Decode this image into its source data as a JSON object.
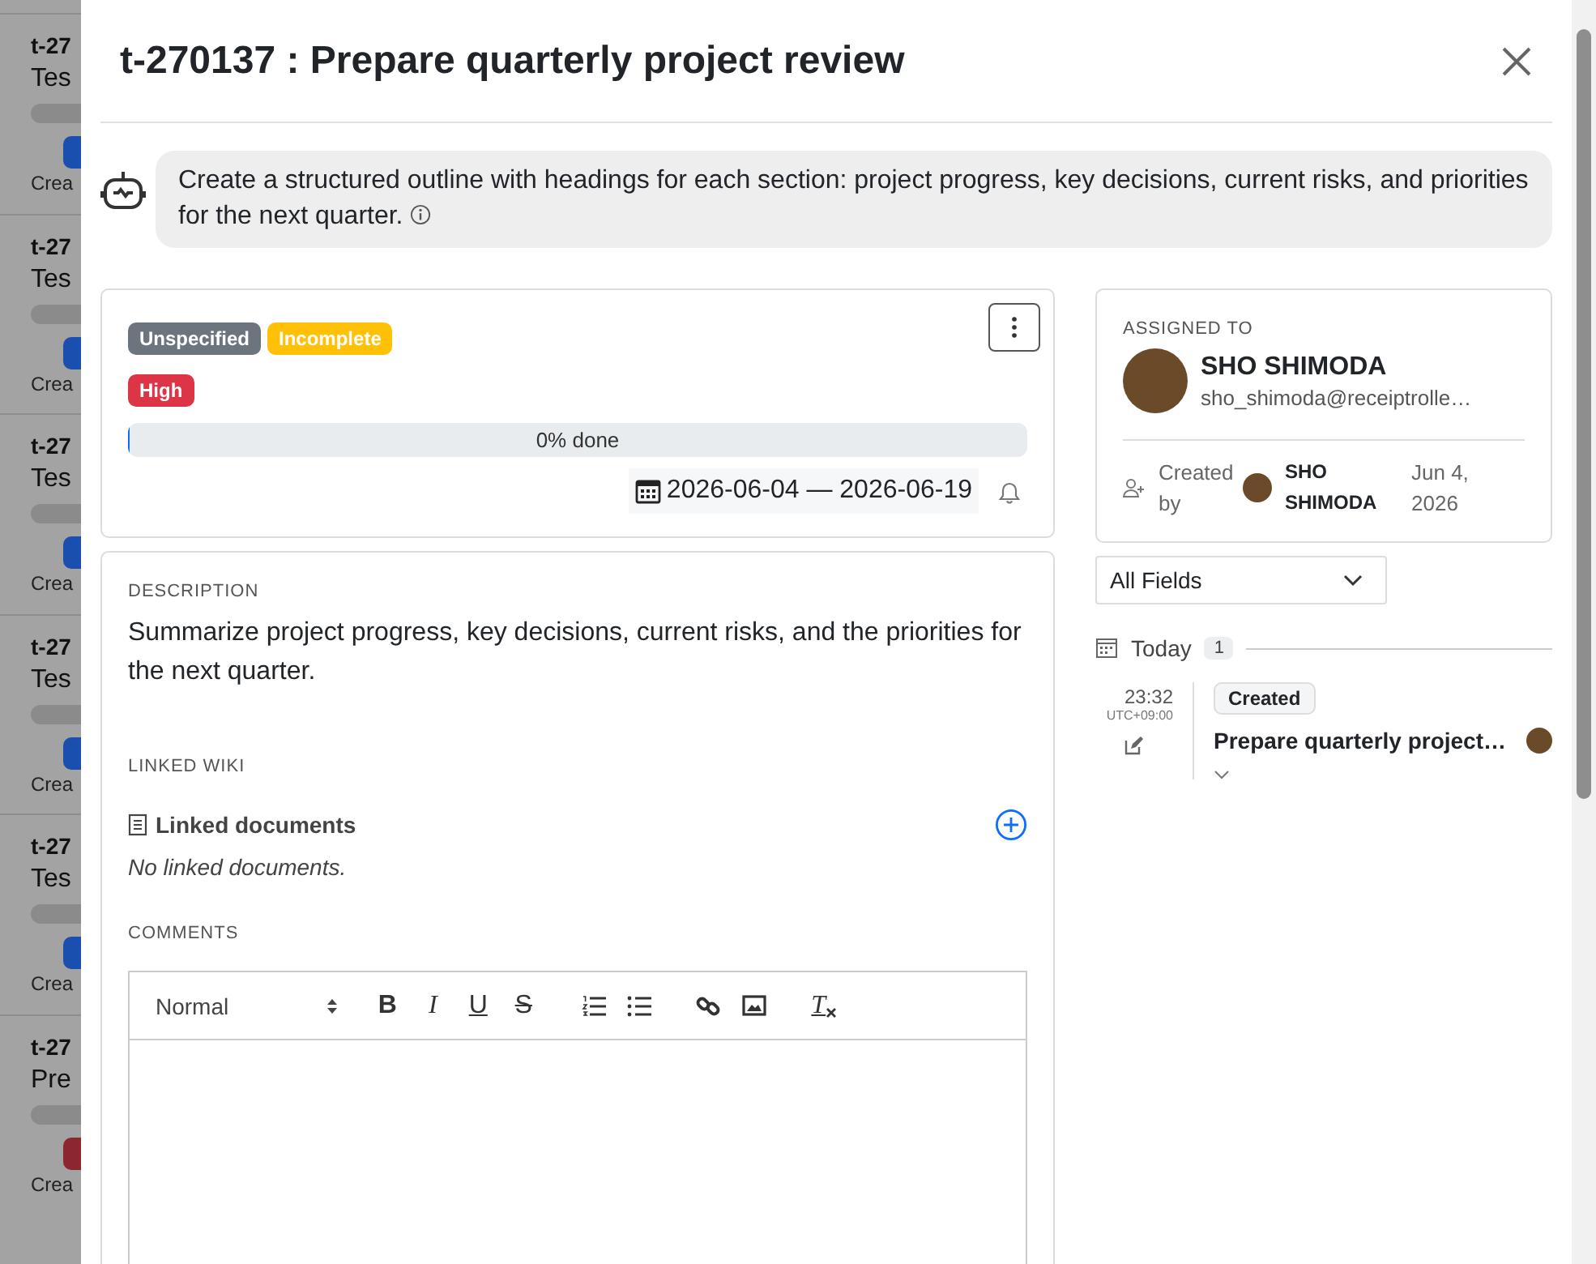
{
  "background_list": [
    {
      "id": "t-27",
      "title": "Tes",
      "color": "#1a4fb0",
      "meta": "Crea"
    },
    {
      "id": "t-27",
      "title": "Tes",
      "color": "#1a4fb0",
      "meta": "Crea"
    },
    {
      "id": "t-27",
      "title": "Tes",
      "color": "#1a4fb0",
      "meta": "Crea"
    },
    {
      "id": "t-27",
      "title": "Tes",
      "color": "#1a4fb0",
      "meta": "Crea"
    },
    {
      "id": "t-27",
      "title": "Tes",
      "color": "#1a4fb0",
      "meta": "Crea"
    },
    {
      "id": "t-27",
      "title": "Pre",
      "color": "#8c2730",
      "meta": "Crea"
    }
  ],
  "task": {
    "title": "t-270137 : Prepare quarterly project review"
  },
  "ai_hint": {
    "text": "Create a structured outline with headings for each section: project progress, key decisions, current risks, and priorities for the next quarter."
  },
  "status_tags": [
    {
      "label": "Unspecified",
      "color": "#6c757d"
    },
    {
      "label": "Incomplete",
      "color": "#ffc107"
    }
  ],
  "priority_tag": {
    "label": "High",
    "color": "#dc3545"
  },
  "progress": {
    "label": "0% done",
    "level": 0
  },
  "date_range": "2026-06-04 — 2026-06-19",
  "description": {
    "heading": "DESCRIPTION",
    "text": "Summarize project progress, key decisions, current risks, and the priorities for the next quarter."
  },
  "linked_wiki": {
    "heading": "LINKED WIKI",
    "title": "Linked documents",
    "empty": "No linked documents."
  },
  "comments": {
    "heading": "COMMENTS",
    "format": "Normal",
    "tools": [
      {
        "kind": "bold",
        "label": "B"
      },
      {
        "kind": "italic",
        "label": "I"
      },
      {
        "kind": "underline",
        "label": "U"
      },
      {
        "kind": "strike",
        "label": "S"
      },
      {
        "kind": "ordered-list"
      },
      {
        "kind": "bullet-list"
      },
      {
        "kind": "link"
      },
      {
        "kind": "image"
      },
      {
        "kind": "clean",
        "label": "T"
      }
    ]
  },
  "assignee": {
    "heading": "ASSIGNED TO",
    "name": "SHO SHIMODA",
    "email": "sho_shimoda@receiptrolle…"
  },
  "created": {
    "label": "Created by",
    "name": "SHO SHIMODA",
    "date": "Jun 4, 2026"
  },
  "filter": {
    "value": "All Fields"
  },
  "activity": {
    "group": "Today",
    "count": "1",
    "entries": [
      {
        "time": "23:32",
        "zone": "UTC+09:00",
        "tag": "Created",
        "text": "Prepare quarterly project…"
      }
    ]
  }
}
